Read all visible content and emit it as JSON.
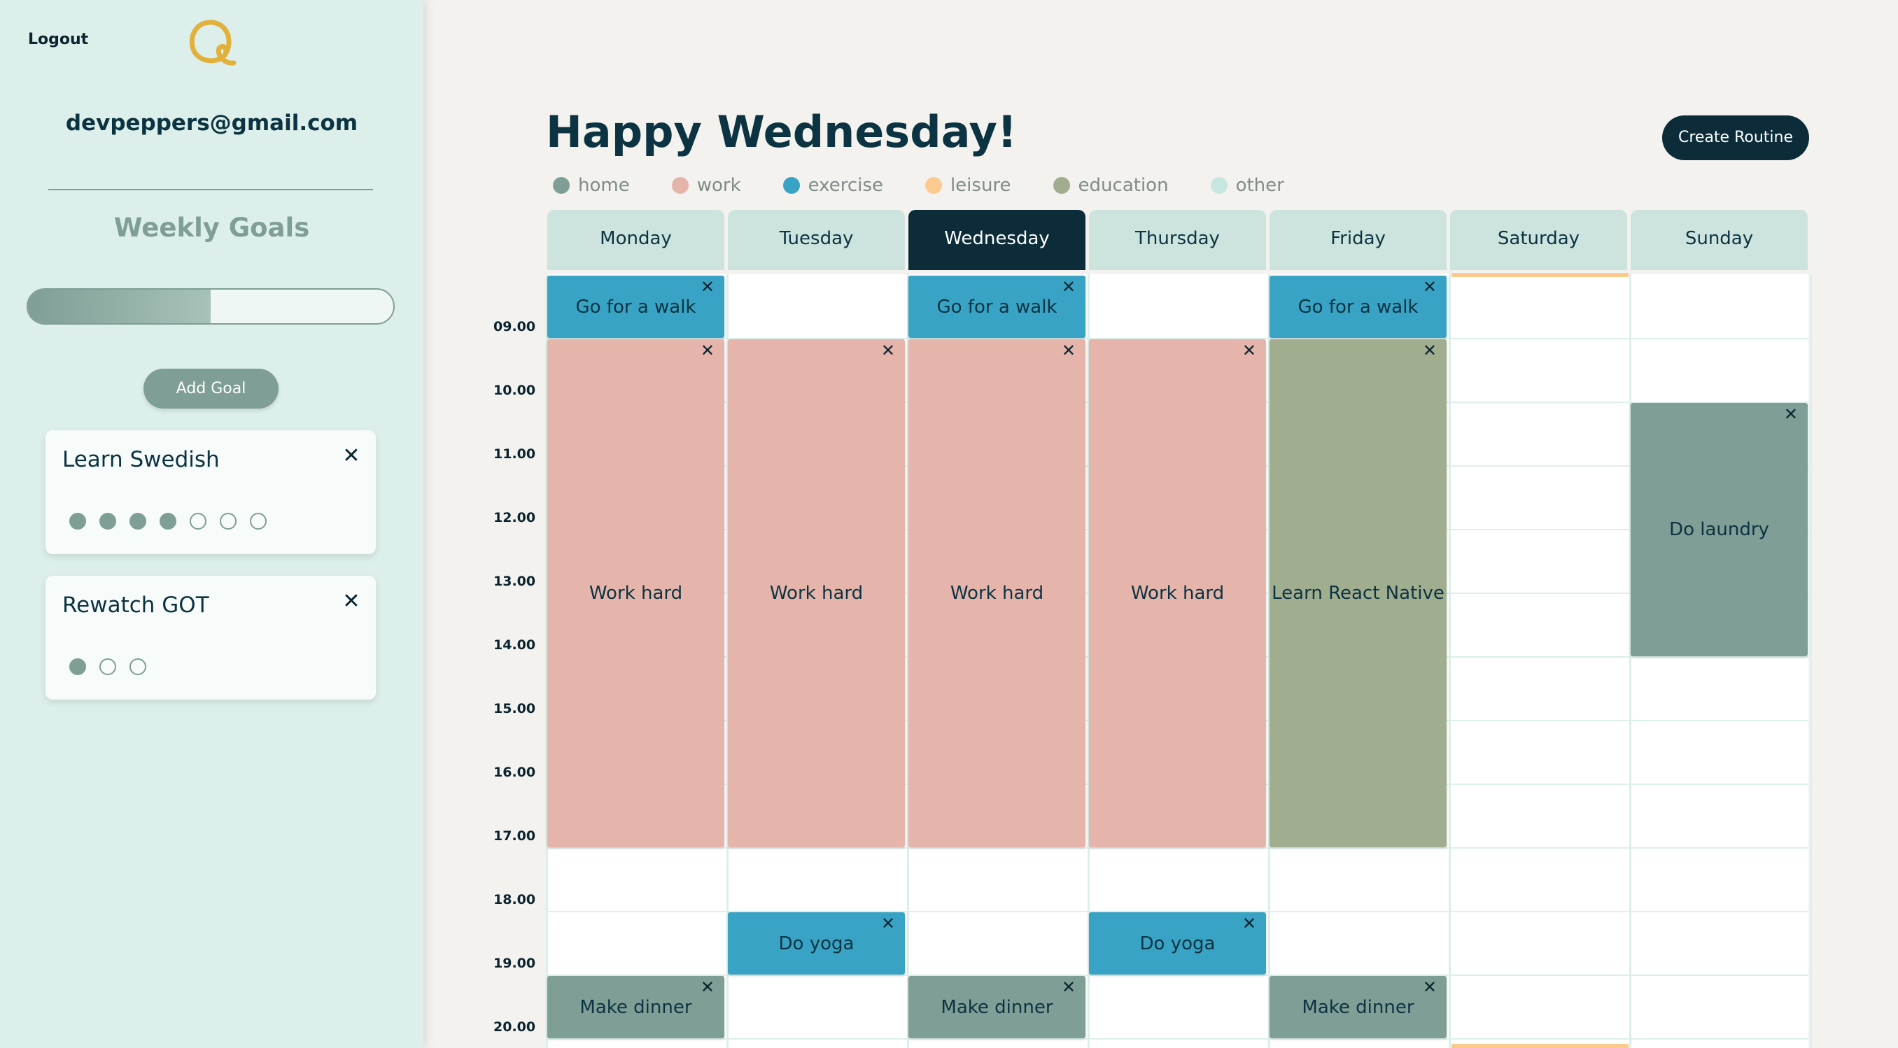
{
  "sidebar": {
    "logout": "Logout",
    "email": "devpeppers@gmail.com",
    "goals_title": "Weekly Goals",
    "progress_fraction": 0.5,
    "add_goal": "Add Goal",
    "goals": [
      {
        "name": "Learn Swedish",
        "close": "✕",
        "total": 7,
        "done": 4
      },
      {
        "name": "Rewatch GOT",
        "close": "✕",
        "total": 3,
        "done": 1
      }
    ]
  },
  "header": {
    "title": "Happy Wednesday!",
    "create_routine": "Create Routine"
  },
  "legend": [
    {
      "label": "home",
      "color": "#7f9e95"
    },
    {
      "label": "work",
      "color": "#e5b4aa"
    },
    {
      "label": "exercise",
      "color": "#38a3c4"
    },
    {
      "label": "leisure",
      "color": "#fcca8f"
    },
    {
      "label": "education",
      "color": "#a0ad8f"
    },
    {
      "label": "other",
      "color": "#c8e6e0"
    }
  ],
  "days": [
    "Monday",
    "Tuesday",
    "Wednesday",
    "Thursday",
    "Friday",
    "Saturday",
    "Sunday"
  ],
  "active_day": "Wednesday",
  "times": [
    "09.00",
    "10.00",
    "11.00",
    "12.00",
    "13.00",
    "14.00",
    "15.00",
    "16.00",
    "17.00",
    "18.00",
    "19.00",
    "20.00"
  ],
  "close_glyph": "✕",
  "events": [
    {
      "day": 0,
      "start": 8,
      "end": 9,
      "title": "Go for a walk",
      "category": "exercise"
    },
    {
      "day": 2,
      "start": 8,
      "end": 9,
      "title": "Go for a walk",
      "category": "exercise"
    },
    {
      "day": 4,
      "start": 8,
      "end": 9,
      "title": "Go for a walk",
      "category": "exercise"
    },
    {
      "day": 0,
      "start": 9,
      "end": 17,
      "title": "Work hard",
      "category": "work"
    },
    {
      "day": 1,
      "start": 9,
      "end": 17,
      "title": "Work hard",
      "category": "work"
    },
    {
      "day": 2,
      "start": 9,
      "end": 17,
      "title": "Work hard",
      "category": "work"
    },
    {
      "day": 3,
      "start": 9,
      "end": 17,
      "title": "Work hard",
      "category": "work"
    },
    {
      "day": 4,
      "start": 9,
      "end": 17,
      "title": "Learn React Native",
      "category": "education"
    },
    {
      "day": 6,
      "start": 10,
      "end": 14,
      "title": "Do laundry",
      "category": "home"
    },
    {
      "day": 1,
      "start": 18,
      "end": 19,
      "title": "Do yoga",
      "category": "exercise"
    },
    {
      "day": 3,
      "start": 18,
      "end": 19,
      "title": "Do yoga",
      "category": "exercise"
    },
    {
      "day": 0,
      "start": 19,
      "end": 20,
      "title": "Make dinner",
      "category": "home"
    },
    {
      "day": 2,
      "start": 19,
      "end": 20,
      "title": "Make dinner",
      "category": "home"
    },
    {
      "day": 4,
      "start": 19,
      "end": 20,
      "title": "Make dinner",
      "category": "home"
    }
  ]
}
